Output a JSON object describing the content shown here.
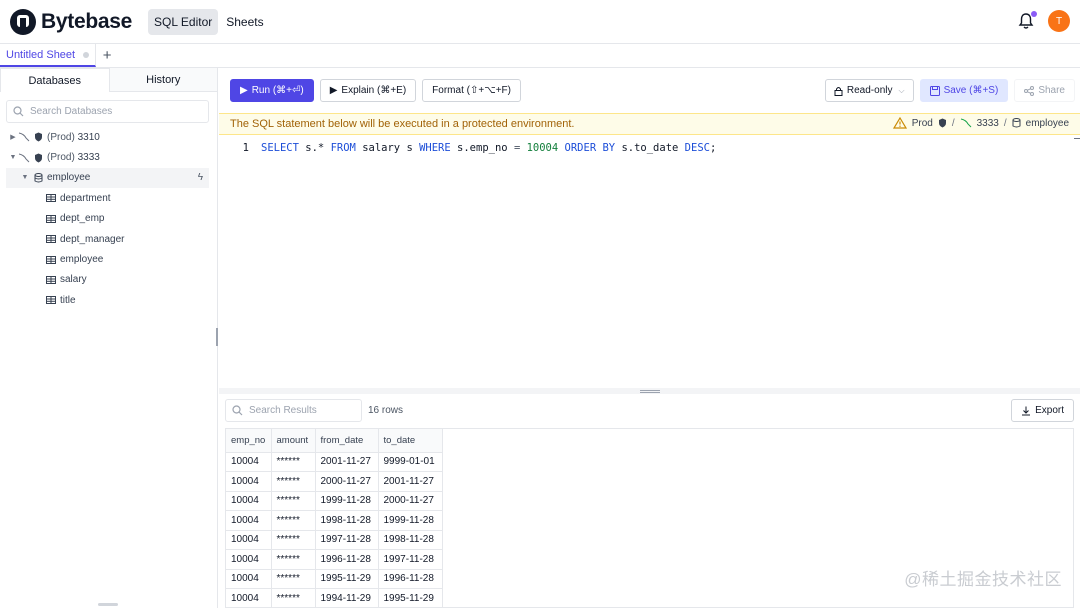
{
  "header": {
    "logo_text": "Bytebase",
    "nav": [
      {
        "label": "SQL Editor",
        "active": true
      },
      {
        "label": "Sheets",
        "active": false
      }
    ],
    "avatar_initial": "T",
    "notification_dot_color": "#8b5cf6",
    "avatar_color": "#f97316"
  },
  "tabs": {
    "items": [
      {
        "label": "Untitled Sheet",
        "active": true
      }
    ],
    "add_label": "+"
  },
  "sidebar": {
    "tabs": [
      {
        "label": "Databases",
        "active": true
      },
      {
        "label": "History",
        "active": false
      }
    ],
    "search_placeholder": "Search Databases",
    "tree": {
      "instances": [
        {
          "env": "(Prod)",
          "name": "3310",
          "expanded": false
        },
        {
          "env": "(Prod)",
          "name": "3333",
          "expanded": true
        }
      ],
      "database": "employee",
      "tables": [
        "department",
        "dept_emp",
        "dept_manager",
        "employee",
        "salary",
        "title"
      ]
    }
  },
  "toolbar": {
    "run_label": "Run (⌘+⏎)",
    "explain_label": "Explain (⌘+E)",
    "format_label": "Format (⇧+⌥+F)",
    "readonly_label": "Read-only",
    "save_label": "Save (⌘+S)",
    "share_label": "Share"
  },
  "warning": {
    "text": "The SQL statement below will be executed in a protected environment.",
    "env": "Prod",
    "instance": "3333",
    "database": "employee",
    "separator": "/"
  },
  "editor": {
    "line_number": "1",
    "tokens": [
      "SELECT",
      "s.*",
      "FROM",
      "salary s",
      "WHERE",
      "s.emp_no",
      "=",
      "10004",
      "ORDER BY",
      "s.to_date",
      "DESC",
      ";"
    ]
  },
  "results": {
    "search_placeholder": "Search Results",
    "row_count": "16 rows",
    "export_label": "Export",
    "columns": [
      "emp_no",
      "amount",
      "from_date",
      "to_date"
    ],
    "rows": [
      [
        "10004",
        "******",
        "2001-11-27",
        "9999-01-01"
      ],
      [
        "10004",
        "******",
        "2000-11-27",
        "2001-11-27"
      ],
      [
        "10004",
        "******",
        "1999-11-28",
        "2000-11-27"
      ],
      [
        "10004",
        "******",
        "1998-11-28",
        "1999-11-28"
      ],
      [
        "10004",
        "******",
        "1997-11-28",
        "1998-11-28"
      ],
      [
        "10004",
        "******",
        "1996-11-28",
        "1997-11-28"
      ],
      [
        "10004",
        "******",
        "1995-11-29",
        "1996-11-28"
      ],
      [
        "10004",
        "******",
        "1994-11-29",
        "1995-11-29"
      ]
    ]
  },
  "watermark": "@稀土掘金技术社区",
  "colors": {
    "accent": "#4f46e5",
    "warning_bg": "#fefce8",
    "warning_text": "#a16207"
  }
}
